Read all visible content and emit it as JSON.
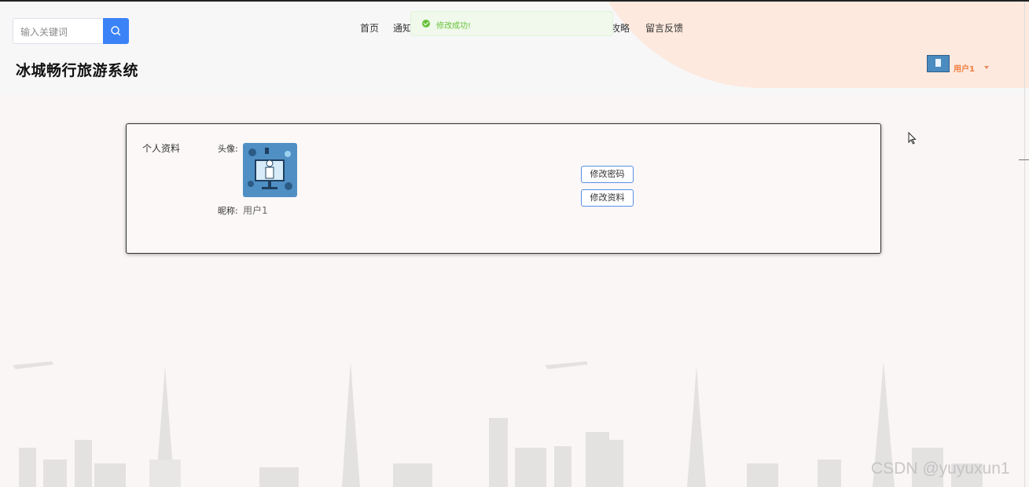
{
  "search": {
    "placeholder": "输入关键词",
    "icon": "search-icon"
  },
  "nav": {
    "items": [
      "首页",
      "通知",
      "攻略",
      "留言反馈"
    ]
  },
  "toast": {
    "text": "修改成功!",
    "type": "success",
    "color": "#67c23a"
  },
  "site": {
    "title": "冰城畅行旅游系统"
  },
  "user": {
    "name": "用户1",
    "menu_icon": "caret-down-icon"
  },
  "profile": {
    "section_title": "个人资料",
    "avatar_label": "头像:",
    "nickname_label": "昵称:",
    "nickname": "用户1",
    "buttons": {
      "change_password": "修改密码",
      "edit_profile": "修改资料"
    }
  },
  "watermark": "CSDN @yuyuxun1",
  "colors": {
    "accent": "#3b82f6",
    "user_name": "#f07b3b",
    "button_border": "#5b8ee6"
  }
}
